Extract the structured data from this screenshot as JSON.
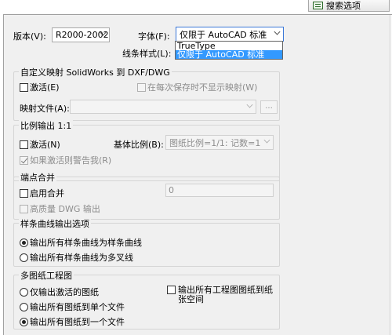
{
  "search": {
    "label": "搜索选项",
    "icon": "search-options-icon"
  },
  "version": {
    "label": "版本(V):",
    "value": "R2000-2002"
  },
  "font": {
    "label": "字体(F):",
    "value": "仅限于 AutoCAD 标准",
    "options": [
      "TrueType",
      "仅限于 AutoCAD 标准"
    ]
  },
  "linestyle": {
    "label": "线条样式(L):"
  },
  "custom_map": {
    "title": "自定义映射 SolidWorks 到 DXF/DWG",
    "activate": "激活(E)",
    "not_show_on_save": "在每次保存时不显示映射(W)",
    "map_file_label": "映射文件(A):",
    "map_file_value": "",
    "browse": "..."
  },
  "scale_output": {
    "title": "比例输出 1:1",
    "activate": "激活(N)",
    "base_scale_label": "基体比例(B):",
    "base_scale_value": "图纸比例=1/1: 记数=1",
    "warn_if_active": "如果激活则警告我(R)"
  },
  "endpoint_merge": {
    "title": "端点合并",
    "enable": "启用合并",
    "value": "0",
    "hq_dwg": "高质量 DWG 输出"
  },
  "spline": {
    "title": "样条曲线输出选项",
    "option1": "输出所有样条曲线为样条曲线",
    "option2": "输出所有样条曲线为多叉线"
  },
  "multisheet": {
    "title": "多图纸工程图",
    "option1": "仅输出激活的图纸",
    "option2": "输出所有图纸到单个文件",
    "option3": "输出所有图纸到一个文件",
    "output_all_to_space": "输出所有工程图图纸到纸张空间"
  },
  "colors": {
    "panel_bg": "#f0f0f0",
    "selected_bg": "#3399ff",
    "focus_border": "#3b78d8"
  }
}
